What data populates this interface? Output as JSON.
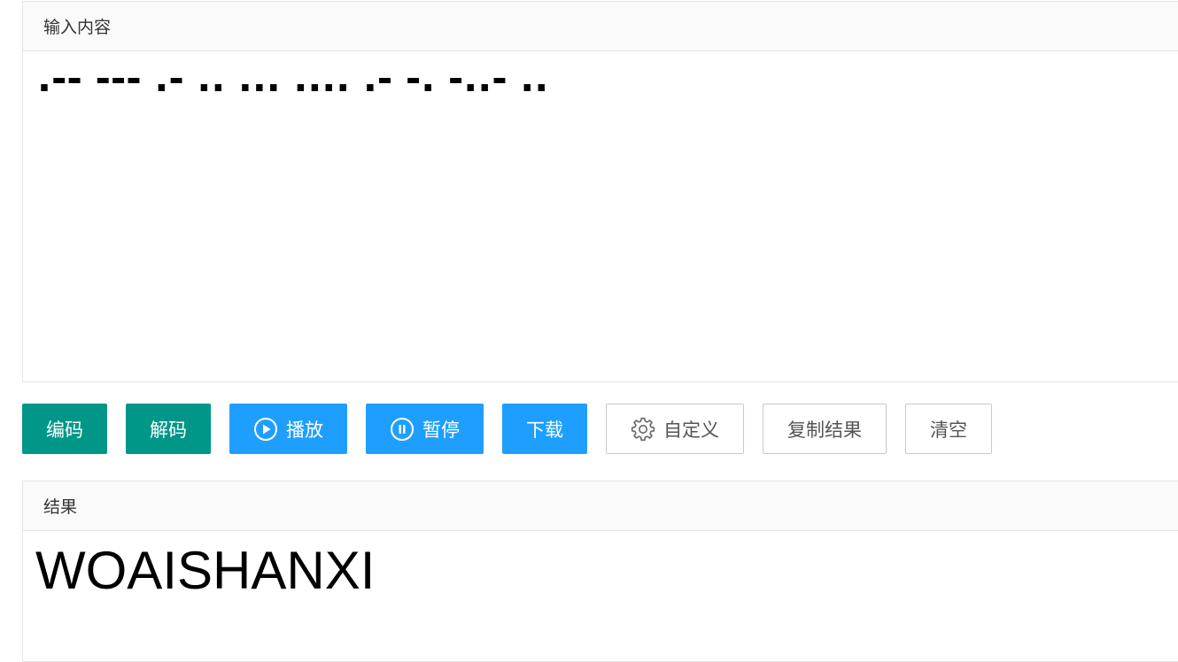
{
  "input_panel": {
    "header": "输入内容",
    "value": ".-- --- .- .. ... .... .- -. -..- .."
  },
  "toolbar": {
    "encode_label": "编码",
    "decode_label": "解码",
    "play_label": "播放",
    "pause_label": "暂停",
    "download_label": "下载",
    "custom_label": "自定义",
    "copy_label": "复制结果",
    "clear_label": "清空"
  },
  "output_panel": {
    "header": "结果",
    "value": "WOAISHANXI"
  },
  "colors": {
    "teal": "#009688",
    "blue": "#1e9fff",
    "border": "#e6e6e6",
    "header_bg": "#fafafa"
  },
  "icons": {
    "play": "play-circle-icon",
    "pause": "pause-circle-icon",
    "custom": "gear-icon"
  }
}
